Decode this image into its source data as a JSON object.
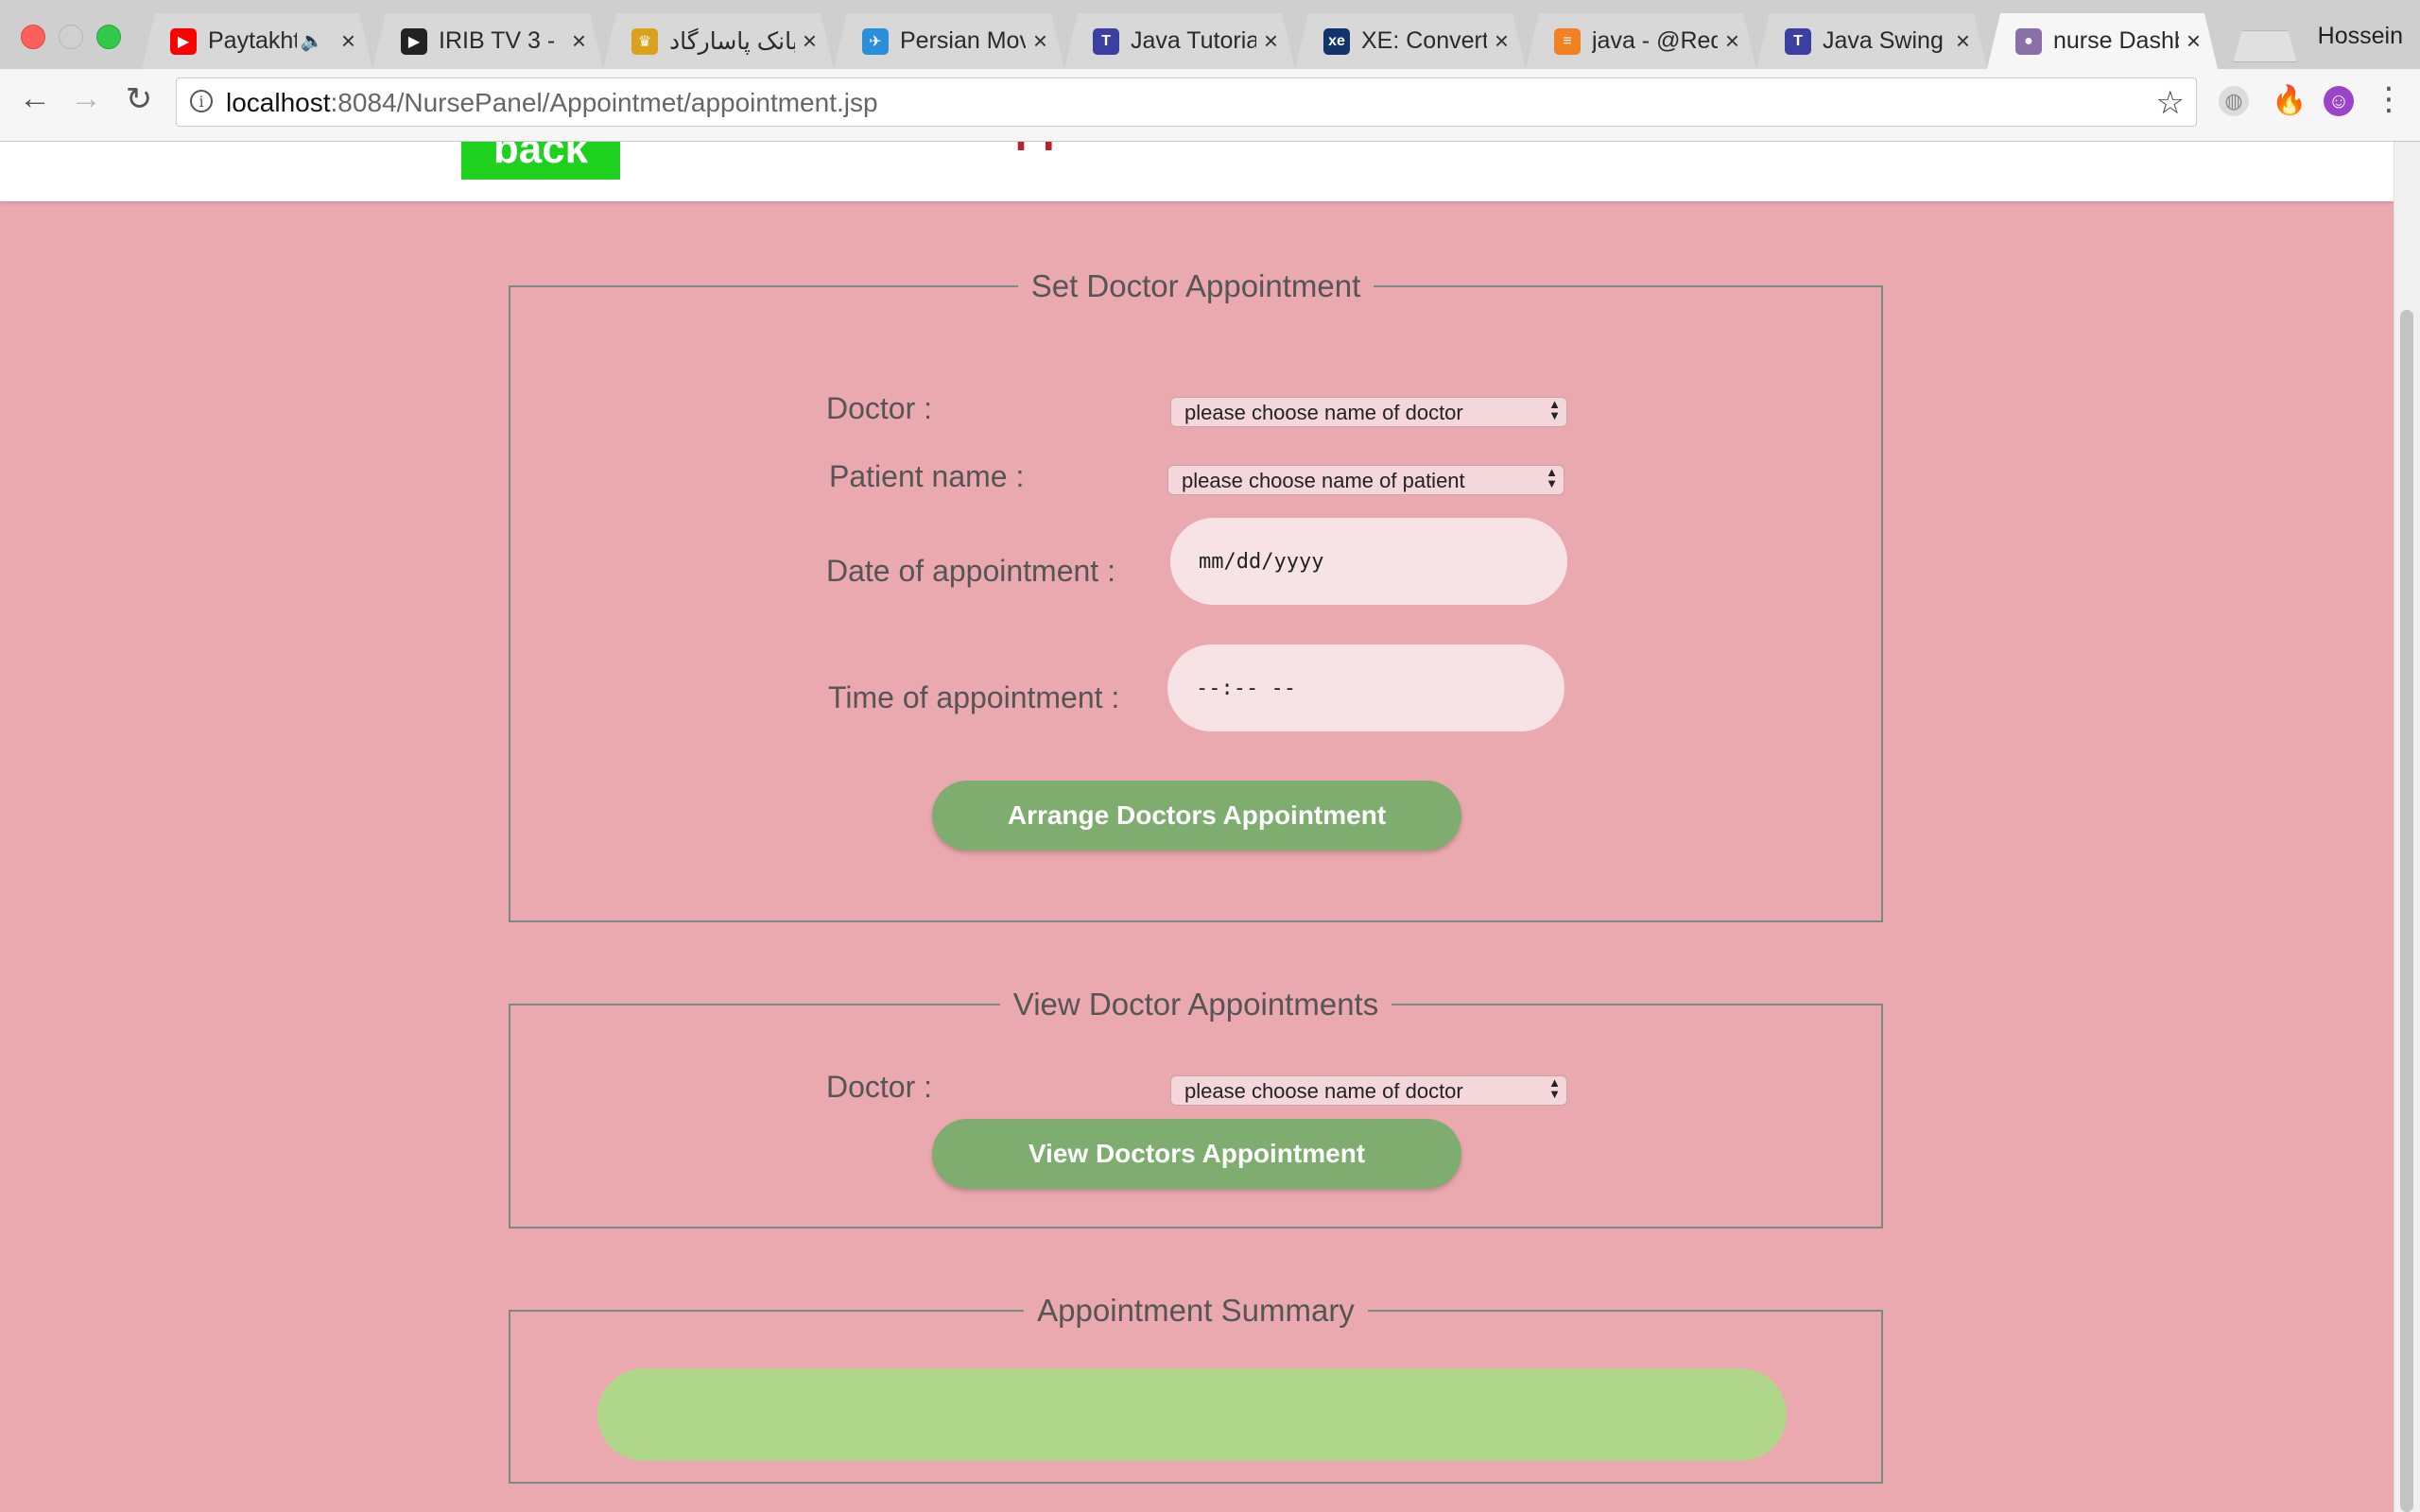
{
  "browser": {
    "tabs": [
      {
        "title": "Paytakht",
        "icon": "youtube-icon",
        "icon_color": "#ff0000",
        "audio": true,
        "active": false
      },
      {
        "title": "IRIB TV 3 - ",
        "icon": "play-icon",
        "icon_color": "#222222",
        "audio": false,
        "active": false
      },
      {
        "title": "بانک پاسارگاد ::",
        "icon": "bank-icon",
        "icon_color": "#d8a21f",
        "audio": false,
        "active": false
      },
      {
        "title": "Persian Mov",
        "icon": "bird-icon",
        "icon_color": "#2a8fd8",
        "audio": false,
        "active": false
      },
      {
        "title": "Java Tutoria",
        "icon": "tutorialspoint-icon",
        "icon_color": "#3a3fa0",
        "audio": false,
        "active": false
      },
      {
        "title": "XE: Convert",
        "icon": "xe-icon",
        "icon_color": "#13336b",
        "audio": false,
        "active": false
      },
      {
        "title": "java - @Req",
        "icon": "stackoverflow-icon",
        "icon_color": "#f48024",
        "audio": false,
        "active": false
      },
      {
        "title": "Java Swing",
        "icon": "tutorialspoint-icon",
        "icon_color": "#3a3fa0",
        "audio": false,
        "active": false
      },
      {
        "title": "nurse Dashb",
        "icon": "avatar-icon",
        "icon_color": "#8a6fa8",
        "audio": false,
        "active": true
      }
    ],
    "profile_name": "Hossein",
    "url_host": "localhost",
    "url_path": ":8084/NursePanel/Appointmet/appointment.jsp"
  },
  "page": {
    "back_label": "back",
    "heading": "doctor appointment"
  },
  "set_section": {
    "legend": "Set Doctor Appointment",
    "doctor_label": "Doctor :",
    "doctor_select": "please choose name of doctor",
    "patient_label": "Patient name :",
    "patient_select": "please choose name of patient",
    "date_label": "Date of appointment :",
    "date_placeholder": "mm/dd/yyyy",
    "time_label": "Time of appointment :",
    "time_placeholder": "--:-- --",
    "submit_label": "Arrange Doctors Appointment"
  },
  "view_section": {
    "legend": "View Doctor Appointments",
    "doctor_label": "Doctor :",
    "doctor_select": "please choose name of doctor",
    "submit_label": "View Doctors Appointment"
  },
  "summary_section": {
    "legend": "Appointment Summary"
  }
}
